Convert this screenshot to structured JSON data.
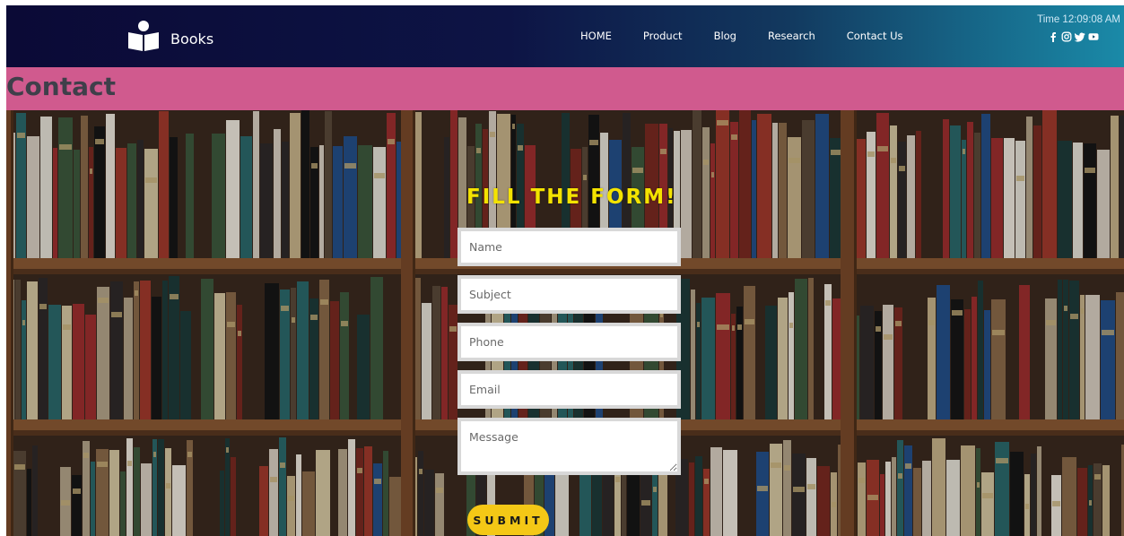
{
  "brand": {
    "name": "Books",
    "icon": "book-reader-icon"
  },
  "nav": {
    "links": [
      {
        "label": "HOME"
      },
      {
        "label": "Product"
      },
      {
        "label": "Blog"
      },
      {
        "label": "Research"
      },
      {
        "label": "Contact Us"
      }
    ],
    "time": "Time 12:09:08 AM",
    "socials": [
      "facebook-icon",
      "instagram-icon",
      "twitter-icon",
      "youtube-icon"
    ]
  },
  "band": {
    "title": "Contact"
  },
  "form": {
    "title": "FILL THE FORM!",
    "name_placeholder": "Name",
    "subject_placeholder": "Subject",
    "phone_placeholder": "Phone",
    "email_placeholder": "Email",
    "message_placeholder": "Message",
    "submit_label": "SUBMIT"
  },
  "colors": {
    "band": "#d05a8e",
    "form_title": "#f4e300",
    "submit": "#f4c816",
    "nav_start": "#0b0a36",
    "nav_end": "#1a8aa8"
  }
}
